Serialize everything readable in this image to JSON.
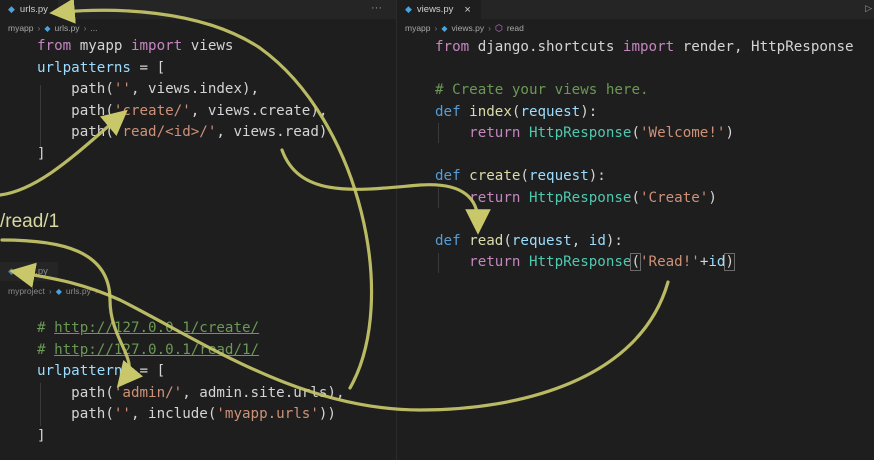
{
  "top_left": {
    "tab": {
      "label": "urls.py"
    },
    "more": "···",
    "crumbs": [
      "myapp",
      "urls.py",
      "..."
    ],
    "code": {
      "l1": [
        "from",
        " myapp ",
        "import",
        " views"
      ],
      "l2": [
        "urlpatterns",
        " = ["
      ],
      "l3": [
        "    path(",
        "''",
        ", views.index),"
      ],
      "l4": [
        "    path(",
        "'create/'",
        ", views.create),"
      ],
      "l5": [
        "    path(",
        "'read/<id>/'",
        ", views.read)"
      ],
      "l6": [
        "]"
      ]
    }
  },
  "side_label": "/read/1",
  "bottom_left": {
    "tab": {
      "label": "urls.py"
    },
    "crumbs": [
      "myproject",
      "urls.py",
      "..."
    ],
    "code": {
      "l1": [
        "# ",
        "http://127.0.0.1/create/"
      ],
      "l2": [
        "# ",
        "http://127.0.0.1/read/1/"
      ],
      "l3": [
        "urlpatterns",
        " = ["
      ],
      "l4": [
        "    path(",
        "'admin/'",
        ", admin.site.urls),"
      ],
      "l5": [
        "    path(",
        "''",
        ", include(",
        "'myapp.urls'",
        "))"
      ],
      "l6": [
        "]"
      ]
    }
  },
  "right": {
    "tab": {
      "label": "views.py",
      "close": "×"
    },
    "crumbs": [
      "myapp",
      "views.py",
      "read"
    ],
    "edge_glyph": "▷",
    "code": {
      "l1": [
        "from",
        " django.shortcuts ",
        "import",
        " render, HttpResponse"
      ],
      "l3": [
        "# Create your views here."
      ],
      "l4": [
        "def",
        " ",
        "index",
        "(",
        "request",
        "):"
      ],
      "l5": [
        "    ",
        "return",
        " ",
        "HttpResponse",
        "(",
        "'Welcome!'",
        ")"
      ],
      "l7": [
        "def",
        " ",
        "create",
        "(",
        "request",
        "):"
      ],
      "l8": [
        "    ",
        "return",
        " ",
        "HttpResponse",
        "(",
        "'Create'",
        ")"
      ],
      "l10": [
        "def",
        " ",
        "read",
        "(",
        "request",
        ", ",
        "id",
        "):"
      ],
      "l11": [
        "    ",
        "return",
        " ",
        "HttpResponse",
        "(",
        "'Read!'",
        "+",
        "id",
        ")"
      ]
    }
  },
  "colors": {
    "background": "#1e1e1e",
    "arrow": "#c8c86a",
    "keyword": "#569cd6",
    "control": "#c586c0",
    "function": "#dcdcaa",
    "string": "#ce9178",
    "variable": "#9cdcfe",
    "class": "#4ec9b0",
    "comment": "#6a9955"
  },
  "icons": [
    "python-file-icon",
    "chevron-right-icon",
    "function-cube-icon",
    "more-icon",
    "close-icon",
    "run-icon"
  ]
}
